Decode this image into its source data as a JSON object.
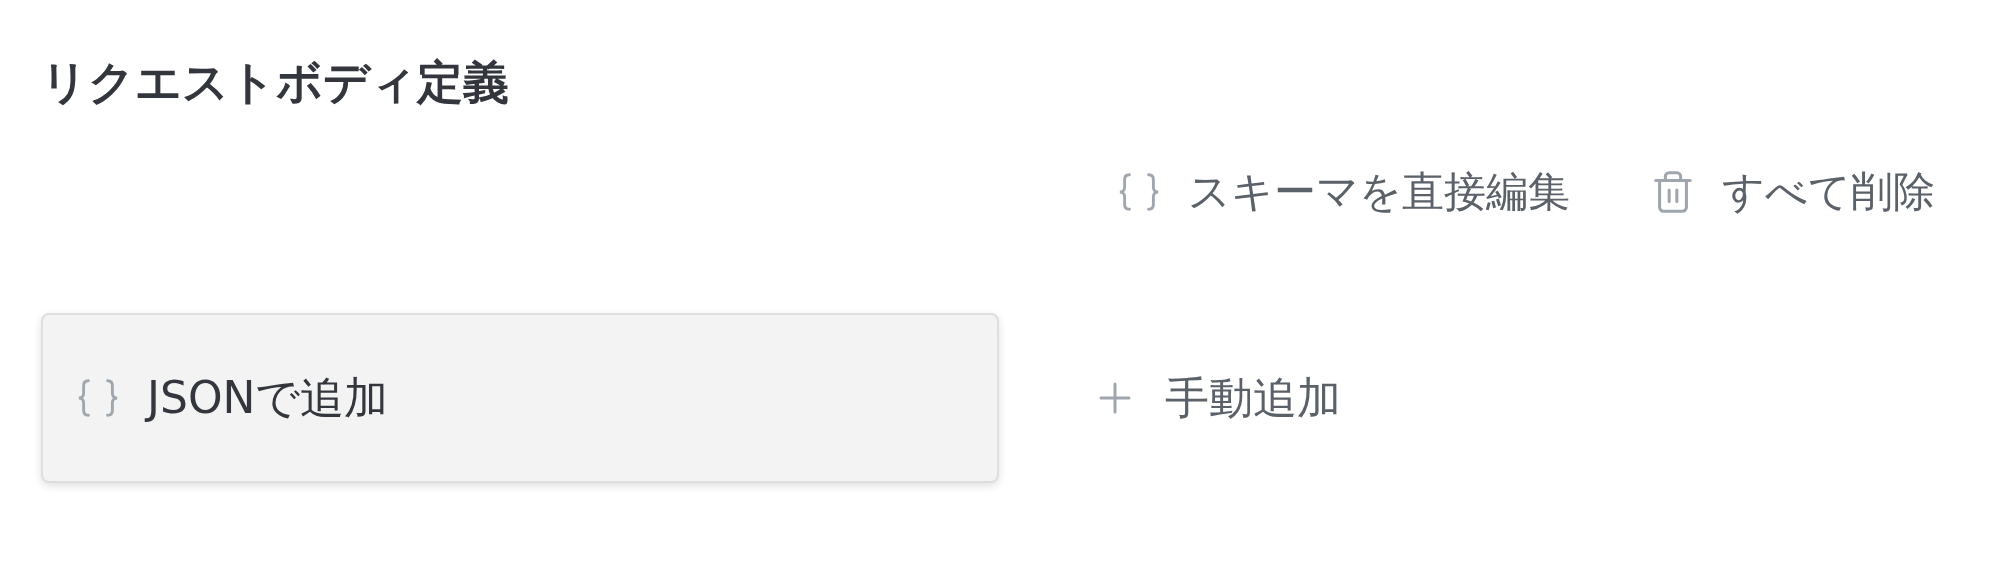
{
  "title": "リクエストボディ定義",
  "actions": [
    {
      "label": "スキーマを直接編集",
      "kind": "schema"
    },
    {
      "label": "すべて削除",
      "kind": "delete"
    }
  ],
  "add_options": [
    {
      "label": "JSONで追加",
      "kind": "json",
      "selected": true
    },
    {
      "label": "手動追加",
      "kind": "manual",
      "selected": false
    }
  ]
}
